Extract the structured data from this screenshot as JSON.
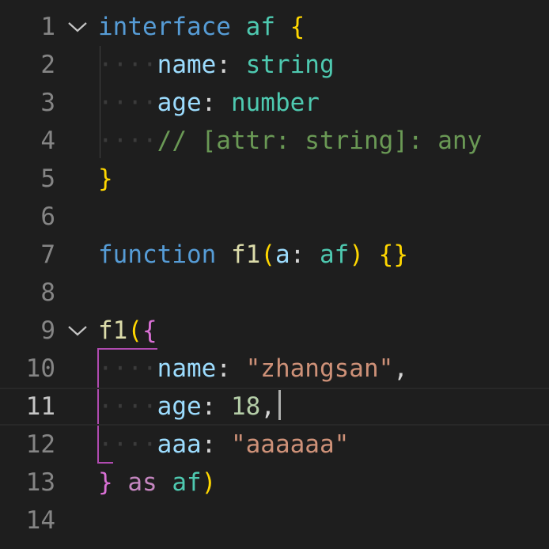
{
  "editor": {
    "language": "typescript",
    "current_line": 11,
    "lines": [
      {
        "num": "1",
        "tokens": [
          {
            "t": "interface",
            "c": "kw"
          },
          {
            "t": " "
          },
          {
            "t": "af",
            "c": "type"
          },
          {
            "t": " "
          },
          {
            "t": "{",
            "c": "brace1"
          }
        ]
      },
      {
        "num": "2",
        "tokens": [
          {
            "t": "····",
            "c": "ws"
          },
          {
            "t": "name",
            "c": "prop"
          },
          {
            "t": ": ",
            "c": "punc"
          },
          {
            "t": "string",
            "c": "type"
          }
        ]
      },
      {
        "num": "3",
        "tokens": [
          {
            "t": "····",
            "c": "ws"
          },
          {
            "t": "age",
            "c": "prop"
          },
          {
            "t": ": ",
            "c": "punc"
          },
          {
            "t": "number",
            "c": "type"
          }
        ]
      },
      {
        "num": "4",
        "tokens": [
          {
            "t": "····",
            "c": "ws"
          },
          {
            "t": "// [attr: string]: any",
            "c": "comment"
          }
        ]
      },
      {
        "num": "5",
        "tokens": [
          {
            "t": "}",
            "c": "brace1"
          }
        ]
      },
      {
        "num": "6",
        "tokens": []
      },
      {
        "num": "7",
        "tokens": [
          {
            "t": "function",
            "c": "kw"
          },
          {
            "t": " "
          },
          {
            "t": "f1",
            "c": "fn"
          },
          {
            "t": "(",
            "c": "brace1"
          },
          {
            "t": "a",
            "c": "param"
          },
          {
            "t": ": ",
            "c": "punc"
          },
          {
            "t": "af",
            "c": "type"
          },
          {
            "t": ")",
            "c": "brace1"
          },
          {
            "t": " "
          },
          {
            "t": "{}",
            "c": "brace1"
          }
        ]
      },
      {
        "num": "8",
        "tokens": []
      },
      {
        "num": "9",
        "tokens": [
          {
            "t": "f1",
            "c": "fn"
          },
          {
            "t": "(",
            "c": "brace1"
          },
          {
            "t": "{",
            "c": "brace2"
          }
        ]
      },
      {
        "num": "10",
        "tokens": [
          {
            "t": "····",
            "c": "ws"
          },
          {
            "t": "name",
            "c": "prop"
          },
          {
            "t": ": ",
            "c": "punc"
          },
          {
            "t": "\"zhangsan\"",
            "c": "str"
          },
          {
            "t": ",",
            "c": "punc"
          }
        ]
      },
      {
        "num": "11",
        "tokens": [
          {
            "t": "····",
            "c": "ws"
          },
          {
            "t": "age",
            "c": "prop"
          },
          {
            "t": ": ",
            "c": "punc"
          },
          {
            "t": "18",
            "c": "num"
          },
          {
            "t": ",",
            "c": "punc"
          }
        ]
      },
      {
        "num": "12",
        "tokens": [
          {
            "t": "····",
            "c": "ws"
          },
          {
            "t": "aaa",
            "c": "prop"
          },
          {
            "t": ": ",
            "c": "punc"
          },
          {
            "t": "\"aaaaaa\"",
            "c": "str"
          }
        ]
      },
      {
        "num": "13",
        "tokens": [
          {
            "t": "}",
            "c": "brace2"
          },
          {
            "t": " "
          },
          {
            "t": "as",
            "c": "kw2"
          },
          {
            "t": " "
          },
          {
            "t": "af",
            "c": "type"
          },
          {
            "t": ")",
            "c": "brace1"
          }
        ]
      },
      {
        "num": "14",
        "tokens": []
      }
    ],
    "fold_lines": [
      "1",
      "9"
    ],
    "colors": {
      "background": "#1e1e1e",
      "keyword": "#569cd6",
      "type": "#4ec9b0",
      "property": "#9cdcfe",
      "string": "#ce9178",
      "number": "#b5cea8",
      "comment": "#6a9955",
      "function": "#dcdcaa",
      "bracket_level1": "#ffd700",
      "bracket_level2": "#da70d6",
      "active_guide": "#b04bb0"
    },
    "icons": {
      "fold": "chevron-down-icon"
    }
  }
}
